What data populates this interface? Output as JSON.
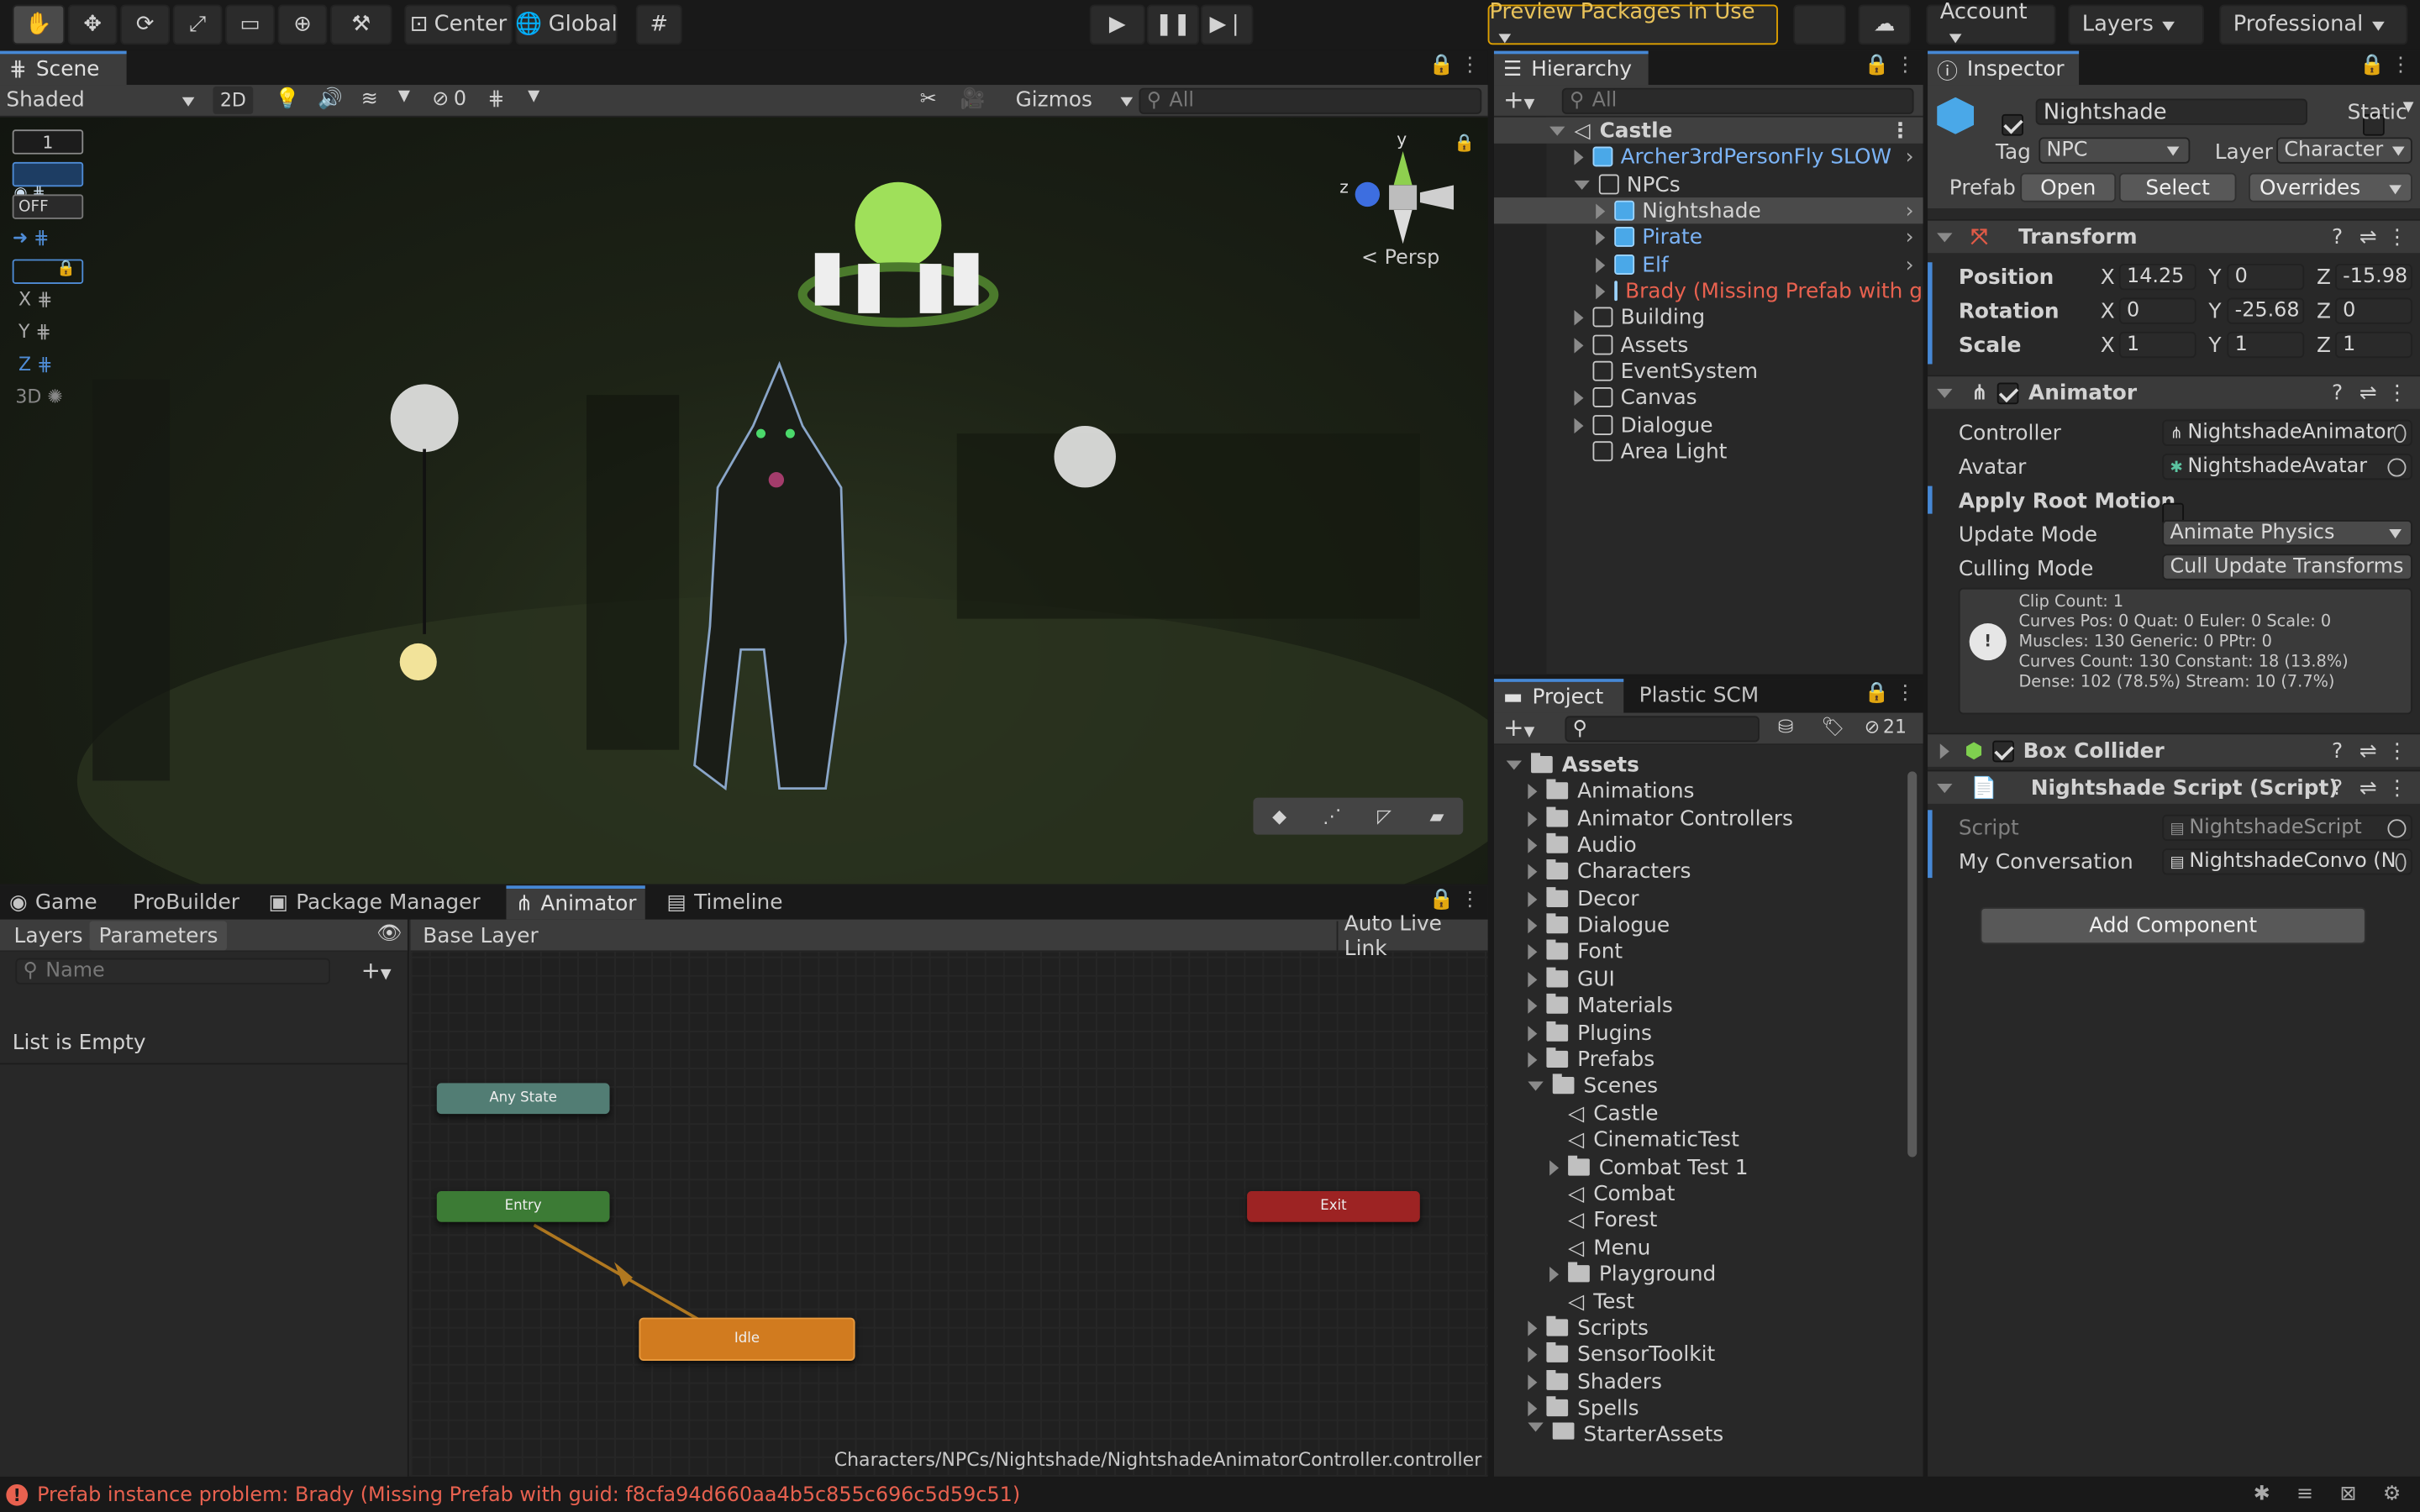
{
  "toolbar": {
    "center_label": "Center",
    "global_label": "Global",
    "preview_packages": "Preview Packages in Use",
    "account": "Account",
    "layers": "Layers",
    "layout": "Professional"
  },
  "scene": {
    "tab_label": "Scene",
    "shading": "Shaded",
    "mode_2d": "2D",
    "hidden_count": "0",
    "gizmos": "Gizmos",
    "search_placeholder": "All",
    "overlay_num": "1",
    "off_label": "OFF",
    "axis_x": "X",
    "axis_y": "Y",
    "axis_z": "Z",
    "label_3d": "3D",
    "gizmo_y": "y",
    "gizmo_z": "z",
    "persp": "Persp"
  },
  "hierarchy": {
    "tab_label": "Hierarchy",
    "search_placeholder": "All",
    "rows": [
      {
        "label": "Castle"
      },
      {
        "label": "Archer3rdPersonFly SLOW"
      },
      {
        "label": "NPCs"
      },
      {
        "label": "Nightshade"
      },
      {
        "label": "Pirate"
      },
      {
        "label": "Elf"
      },
      {
        "label": "Brady (Missing Prefab with guid"
      },
      {
        "label": "Building"
      },
      {
        "label": "Assets"
      },
      {
        "label": "EventSystem"
      },
      {
        "label": "Canvas"
      },
      {
        "label": "Dialogue"
      },
      {
        "label": "Area Light"
      }
    ]
  },
  "project": {
    "tab_project": "Project",
    "tab_plastic": "Plastic SCM",
    "hidden_count": "21",
    "rows": [
      {
        "label": "Assets"
      },
      {
        "label": "Animations"
      },
      {
        "label": "Animator Controllers"
      },
      {
        "label": "Audio"
      },
      {
        "label": "Characters"
      },
      {
        "label": "Decor"
      },
      {
        "label": "Dialogue"
      },
      {
        "label": "Font"
      },
      {
        "label": "GUI"
      },
      {
        "label": "Materials"
      },
      {
        "label": "Plugins"
      },
      {
        "label": "Prefabs"
      },
      {
        "label": "Scenes"
      },
      {
        "label": "Castle"
      },
      {
        "label": "CinematicTest"
      },
      {
        "label": "Combat Test 1"
      },
      {
        "label": "Combat"
      },
      {
        "label": "Forest"
      },
      {
        "label": "Menu"
      },
      {
        "label": "Playground"
      },
      {
        "label": "Test"
      },
      {
        "label": "Scripts"
      },
      {
        "label": "SensorToolkit"
      },
      {
        "label": "Shaders"
      },
      {
        "label": "Spells"
      },
      {
        "label": "StarterAssets"
      }
    ]
  },
  "inspector": {
    "tab_label": "Inspector",
    "object_name": "Nightshade",
    "static_label": "Static",
    "tag_label": "Tag",
    "tag_value": "NPC",
    "layer_label": "Layer",
    "layer_value": "Character",
    "prefab_label": "Prefab",
    "open_btn": "Open",
    "select_btn": "Select",
    "overrides_btn": "Overrides",
    "transform": {
      "title": "Transform",
      "position_label": "Position",
      "rotation_label": "Rotation",
      "scale_label": "Scale",
      "x": "X",
      "y": "Y",
      "z": "Z",
      "position": {
        "x": "14.25",
        "y": "0",
        "z": "-15.98"
      },
      "rotation": {
        "x": "0",
        "y": "-25.68",
        "z": "0"
      },
      "scale": {
        "x": "1",
        "y": "1",
        "z": "1"
      }
    },
    "animator": {
      "title": "Animator",
      "controller_label": "Controller",
      "controller_value": "NightshadeAnimator",
      "avatar_label": "Avatar",
      "avatar_value": "NightshadeAvatar",
      "apply_root_label": "Apply Root Motion",
      "update_mode_label": "Update Mode",
      "update_mode_value": "Animate Physics",
      "culling_mode_label": "Culling Mode",
      "culling_mode_value": "Cull Update Transforms",
      "info_line1": "Clip Count: 1",
      "info_line2": "Curves Pos: 0 Quat: 0 Euler: 0 Scale: 0 Muscles: 130 Generic: 0 PPtr: 0",
      "info_line3": "Curves Count: 130 Constant: 18 (13.8%) Dense: 102 (78.5%) Stream: 10 (7.7%)"
    },
    "box_collider": {
      "title": "Box Collider"
    },
    "script": {
      "title": "Nightshade Script (Script)",
      "script_label": "Script",
      "script_value": "NightshadeScript",
      "conv_label": "My Conversation",
      "conv_value": "NightshadeConvo (N"
    },
    "add_component": "Add Component"
  },
  "bottom_tabs": {
    "game": "Game",
    "probuilder": "ProBuilder",
    "package_manager": "Package Manager",
    "animator": "Animator",
    "timeline": "Timeline"
  },
  "animator_window": {
    "layers_tab": "Layers",
    "parameters_tab": "Parameters",
    "base_layer": "Base Layer",
    "auto_live_link": "Auto Live Link",
    "name_placeholder": "Name",
    "list_empty": "List is Empty",
    "nodes": {
      "any_state": "Any State",
      "entry": "Entry",
      "exit": "Exit",
      "idle": "Idle"
    },
    "path": "Characters/NPCs/Nightshade/NightshadeAnimatorController.controller"
  },
  "status": {
    "message": "Prefab instance problem: Brady (Missing Prefab with guid: f8cfa94d660aa4b5c855c696c5d59c51)"
  },
  "colors": {
    "accent_blue": "#4688d5",
    "prefab_blue": "#7bb3f5",
    "error_red": "#e8614f",
    "preview_border": "#e0a100",
    "node_orange": "#d17b1f",
    "node_green": "#3c7b35",
    "node_teal": "#527d74",
    "node_red": "#9d2323"
  }
}
